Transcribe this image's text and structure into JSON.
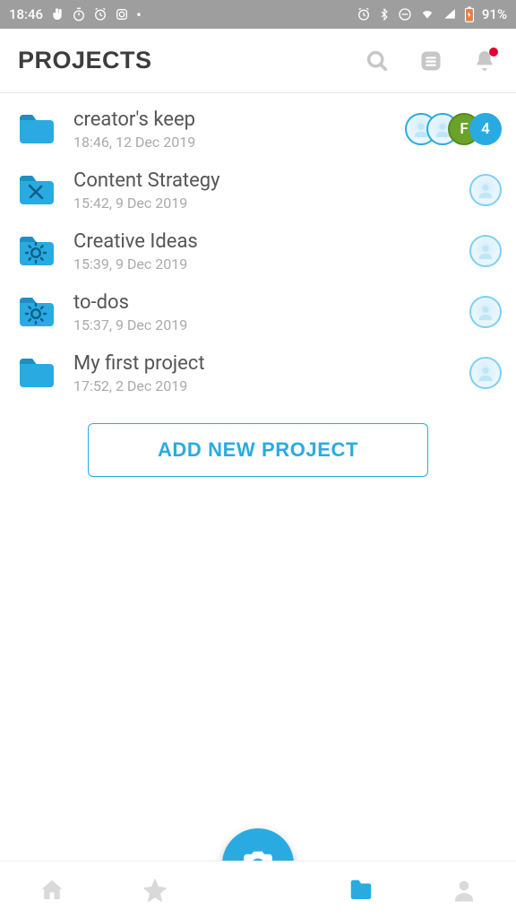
{
  "status": {
    "time": "18:46",
    "battery": "91%"
  },
  "header": {
    "title": "PROJECTS"
  },
  "projects": [
    {
      "title": "creator's keep",
      "subtitle": "18:46, 12 Dec 2019",
      "folder_icon": "plain",
      "avatars": [
        "empty",
        "empty",
        "F",
        "4"
      ],
      "avatar_styles": [
        "",
        "",
        "green",
        "blue"
      ]
    },
    {
      "title": "Content Strategy",
      "subtitle": "15:42, 9 Dec 2019",
      "folder_icon": "tools",
      "single_avatar": true
    },
    {
      "title": "Creative Ideas",
      "subtitle": "15:39, 9 Dec 2019",
      "folder_icon": "bulb",
      "single_avatar": true
    },
    {
      "title": "to-dos",
      "subtitle": "15:37, 9 Dec 2019",
      "folder_icon": "bulb",
      "single_avatar": true
    },
    {
      "title": "My first project",
      "subtitle": "17:52, 2 Dec 2019",
      "folder_icon": "plain",
      "single_avatar": true
    }
  ],
  "add_button": "ADD NEW PROJECT"
}
